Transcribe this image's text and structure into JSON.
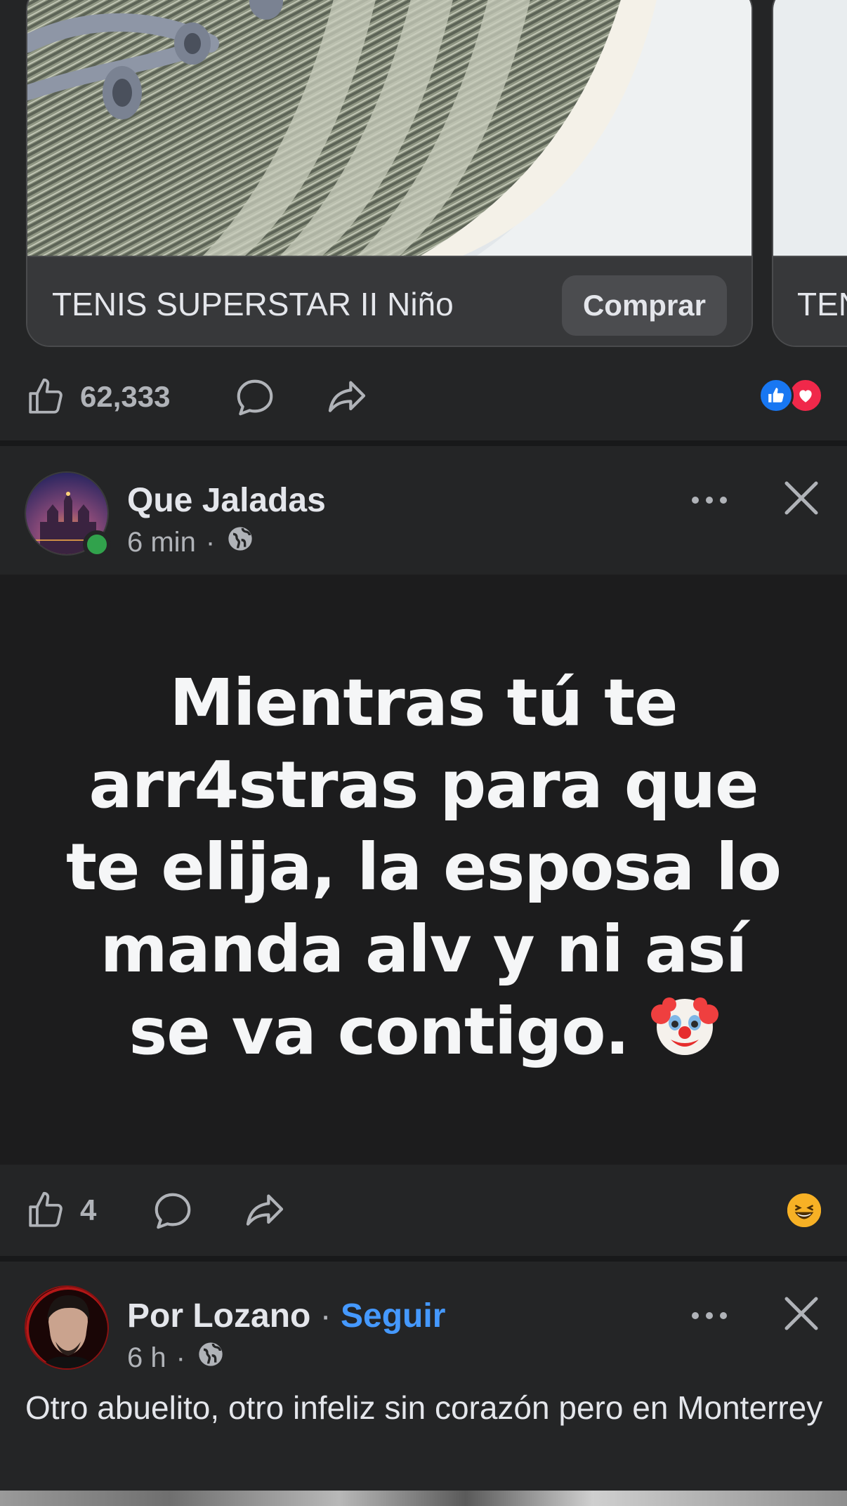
{
  "ad_carousel": {
    "cards": [
      {
        "title": "TENIS SUPERSTAR II Niño",
        "button": "Comprar"
      },
      {
        "title": "TENIS SUPERSTAR II Niño",
        "visible_title": "TEN"
      }
    ],
    "reactions": {
      "count": "62,333",
      "types": [
        "like",
        "love"
      ]
    }
  },
  "post1": {
    "author": "Que Jaladas",
    "time": "6 min",
    "privacy_icon": "globe-icon",
    "online": true,
    "text": "Mientras tú te arr4stras para que te elija, la esposa lo manda alv y ni así se va contigo.",
    "text_emoji": "🤡",
    "post_bg": "#1c1c1d",
    "reactions": {
      "count": "4",
      "types": [
        "haha"
      ]
    }
  },
  "post2": {
    "author": "Por Lozano",
    "separator": "·",
    "follow_label": "Seguir",
    "time": "6 h",
    "privacy_icon": "globe-icon",
    "caption": "Otro abuelito, otro infeliz sin corazón pero en Monterrey"
  },
  "colors": {
    "background": "#242526",
    "accent_link": "#4599ff",
    "like_blue": "#1877f2",
    "love_red": "#f0284a",
    "online_green": "#31a24c"
  }
}
